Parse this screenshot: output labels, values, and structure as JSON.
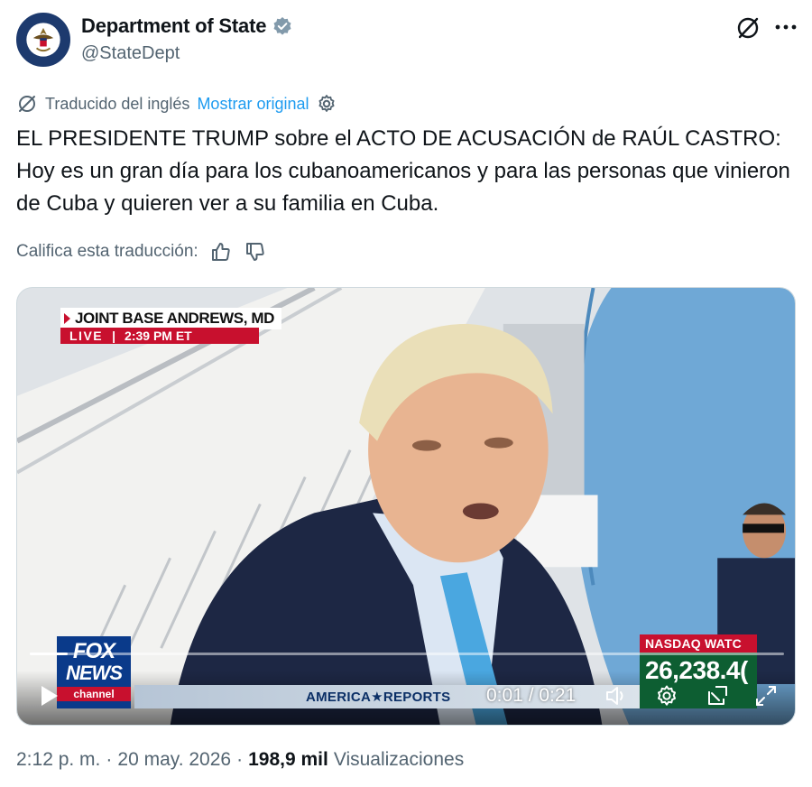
{
  "author": {
    "display_name": "Department of State",
    "handle": "@StateDept",
    "verified": true
  },
  "translation": {
    "translated_from": "Traducido del inglés",
    "show_original": "Mostrar original"
  },
  "tweet": {
    "text": "EL PRESIDENTE TRUMP sobre el ACTO DE ACUSACIÓN de RAÚL CASTRO: Hoy es un gran día para los cubanoamericanos y para las personas que vinieron de Cuba y quieren ver a su familia en Cuba."
  },
  "rating": {
    "label": "Califica esta traducción:"
  },
  "video": {
    "location": "JOINT BASE ANDREWS, MD",
    "live_label": "LIVE",
    "live_time": "2:39 PM ET",
    "channel_logo_top": "FOX",
    "channel_logo_mid": "NEWS",
    "channel_logo_bottom": "channel",
    "program_name": "AMERICA★REPORTS",
    "nasdaq_label": "NASDAQ WATC",
    "nasdaq_value": "26,238.4(",
    "time_display": "0:01 / 0:21",
    "progress_fraction": 0.05
  },
  "footer": {
    "time": "2:12 p. m.",
    "date": "20 may. 2026",
    "views_count": "198,9 mil",
    "views_label": "Visualizaciones"
  },
  "colors": {
    "link": "#1d9bf0",
    "secondary_text": "#536471",
    "verified": "#829aab",
    "fox_red": "#c8102e"
  },
  "icons": {
    "grok": "slashed-circle-icon",
    "more": "more-dots-icon",
    "translate": "translate-icon",
    "settings": "gear-icon",
    "thumbs_up": "thumbs-up-icon",
    "thumbs_down": "thumbs-down-icon",
    "play": "play-icon",
    "volume": "volume-icon",
    "video_settings": "gear-icon",
    "pip": "picture-in-picture-icon",
    "fullscreen": "fullscreen-icon"
  }
}
